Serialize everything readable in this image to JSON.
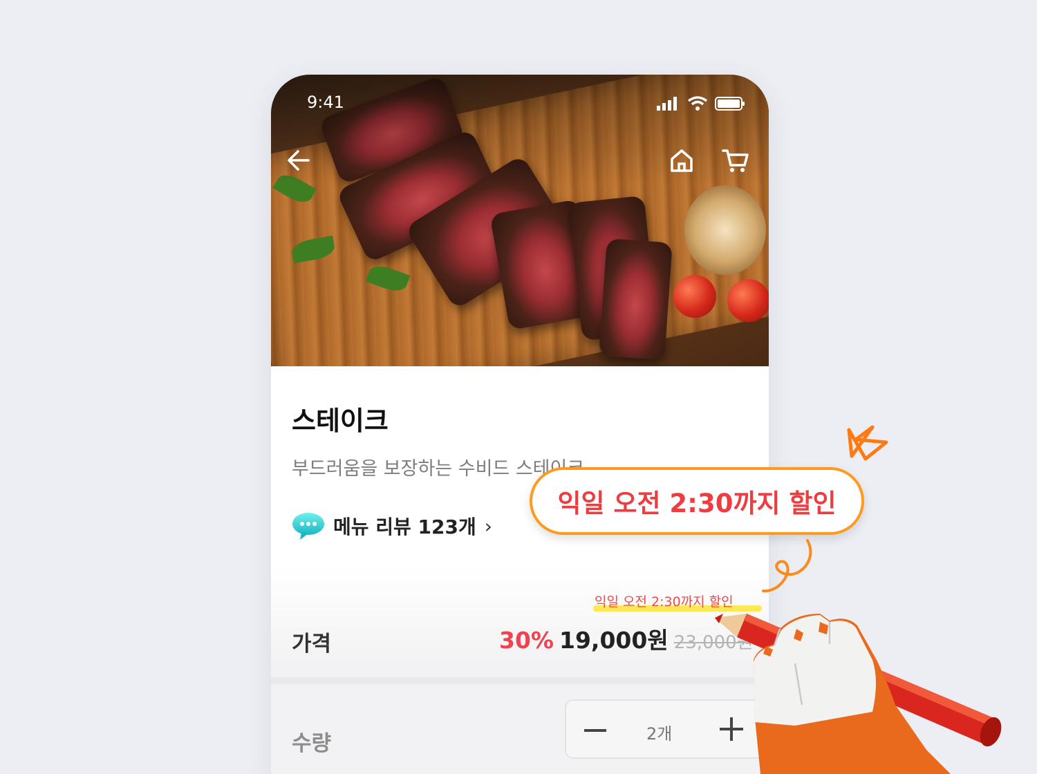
{
  "status": {
    "time": "9:41"
  },
  "product": {
    "title": "스테이크",
    "description": "부드러움을 보장하는 수비드 스테이크",
    "review_label": "메뉴 리뷰 123개",
    "review_chevron": "›"
  },
  "price": {
    "label": "가격",
    "promo_note": "익일 오전 2:30까지 할인",
    "discount": "30%",
    "sale_price": "19,000원",
    "original_price": "23,000원"
  },
  "quantity": {
    "label": "수량",
    "value": "2개"
  },
  "callout": {
    "text": "익일 오전 2:30까지 할인"
  },
  "icons": {
    "back": "arrow-left-icon",
    "home": "home-icon",
    "cart": "cart-icon",
    "review": "chat-bubble-icon"
  },
  "colors": {
    "accent": "#ff9a1f",
    "discount": "#f0434f",
    "highlight": "#ffe642"
  }
}
